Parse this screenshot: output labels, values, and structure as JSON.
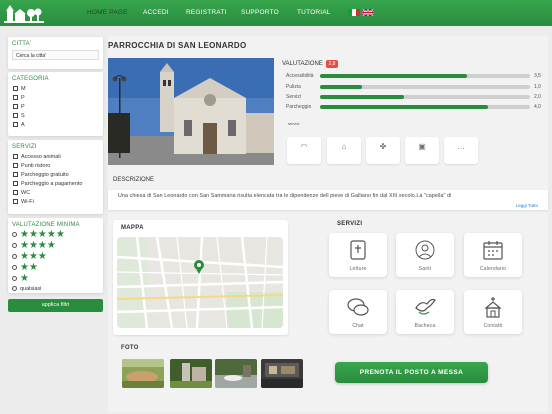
{
  "nav": {
    "items": [
      "HOME PAGE",
      "ACCEDI",
      "REGISTRATI",
      "SUPPORTO",
      "TUTORIAL"
    ],
    "active": "HOME PAGE"
  },
  "sidebar": {
    "city": {
      "title": "CITTA'",
      "placeholder": "Cerca la citta'"
    },
    "category": {
      "title": "CATEGORIA",
      "items": [
        "M",
        "P",
        "P",
        "S",
        "A"
      ]
    },
    "services": {
      "title": "SERVIZI",
      "items": [
        "Accesso animali",
        "Punti ristoro",
        "Parcheggio gratuito",
        "Parcheggio a pagamento",
        "WC",
        "Wi-Fi"
      ]
    },
    "rating": {
      "title": "VALUTAZIONE MINIMA",
      "levels": [
        5,
        4,
        3,
        2,
        1
      ],
      "any_label": "qualsiasi"
    },
    "apply_label": "applica filtri"
  },
  "place": {
    "title": "PARROCCHIA DI SAN LEONARDO",
    "rating_title": "VALUTAZIONE",
    "rating_badge": "2,8",
    "ratings": [
      {
        "label": "Accessibilità",
        "value": "3,5",
        "fraction": 0.7
      },
      {
        "label": "Pulizia",
        "value": "1,0",
        "fraction": 0.2
      },
      {
        "label": "Servizi",
        "value": "2,0",
        "fraction": 0.4
      },
      {
        "label": "Parcheggio",
        "value": "4,0",
        "fraction": 0.8
      }
    ],
    "small_services_label": "servizi",
    "description_title": "DESCRIZIONE",
    "description": "Una chiesa di San Leonardo con San Sammaria risulta elencata tra le dipendenze dell pieve di Galliano fin dal XIII secolo.La \"capella\" di",
    "read_more": "Leggi Tutto",
    "map_title": "MAPPA",
    "services_title": "SERVIZI",
    "service_buttons": [
      "Letture",
      "Santi",
      "Calendario",
      "Chat",
      "Bacheca",
      "Contatti"
    ],
    "photos_title": "FOTO",
    "book_label": "PRENOTA IL POSTO A MESSA"
  }
}
